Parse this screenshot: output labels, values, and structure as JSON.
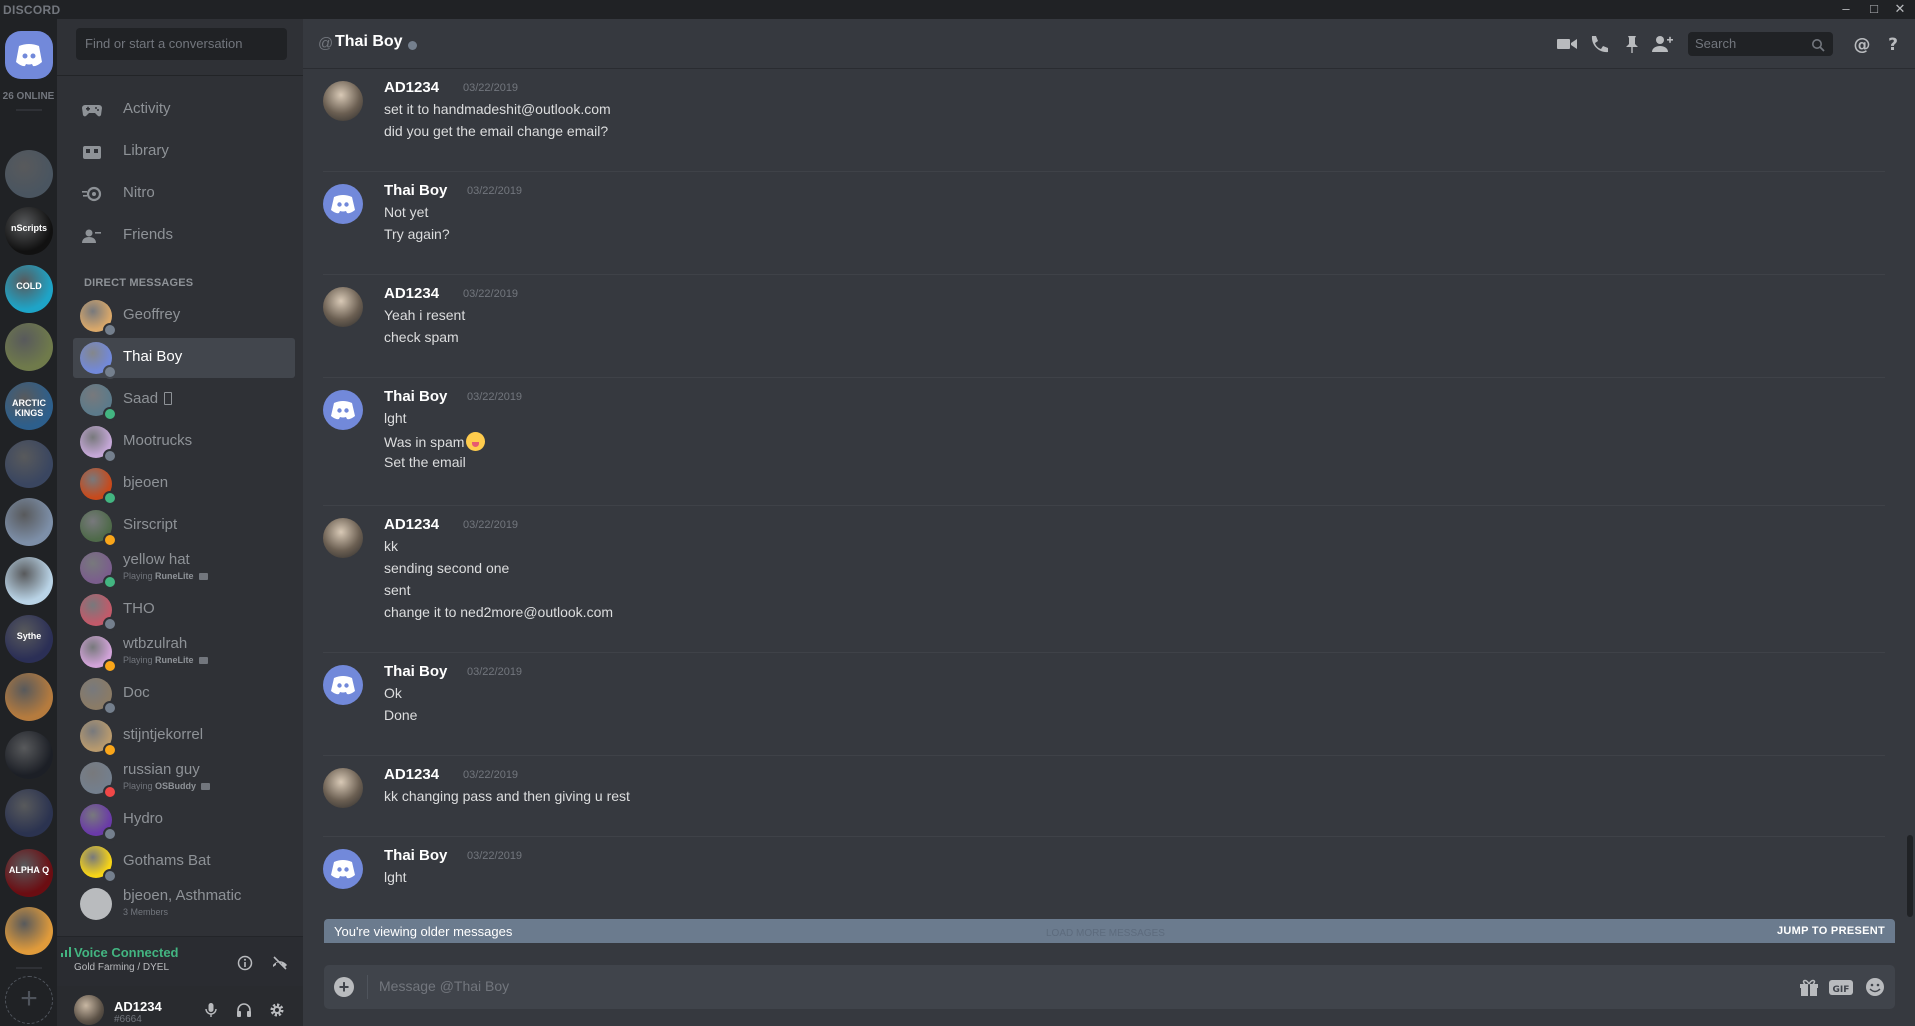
{
  "app": {
    "brand": "DISCORD",
    "window_controls": [
      "minimize-icon",
      "maximize-icon",
      "close-icon"
    ]
  },
  "servers": {
    "online_count": "26 ONLINE",
    "items": [
      {
        "name": "server-dark-ring",
        "color": "#4a5560"
      },
      {
        "name": "server-nscripts",
        "label": "nScripts",
        "color": "#111111"
      },
      {
        "name": "server-cold",
        "label": "COLD",
        "color": "#1ea4c7"
      },
      {
        "name": "server-palm",
        "color": "#6f7a4b"
      },
      {
        "name": "server-arctic-kings",
        "label": "ARCTIC KINGS",
        "color": "#2d5f8c"
      },
      {
        "name": "server-gorilla",
        "color": "#3a4660"
      },
      {
        "name": "server-otter",
        "color": "#7d8fa8"
      },
      {
        "name": "server-face",
        "color": "#b9d3e6"
      },
      {
        "name": "server-sythe",
        "label": "Sythe",
        "color": "#2b2f56"
      },
      {
        "name": "server-warrior",
        "color": "#b57b3e"
      },
      {
        "name": "server-batman",
        "color": "#1c1f26"
      },
      {
        "name": "server-knights",
        "color": "#2b3350"
      },
      {
        "name": "server-alpha",
        "label": "ALPHA Q",
        "color": "#6b0d12"
      },
      {
        "name": "server-hut",
        "color": "#e09b3b"
      }
    ]
  },
  "sidebar": {
    "finder_placeholder": "Find or start a conversation",
    "nav": [
      {
        "label": "Activity",
        "icon": "gamepad-icon"
      },
      {
        "label": "Library",
        "icon": "library-icon"
      },
      {
        "label": "Nitro",
        "icon": "nitro-icon"
      },
      {
        "label": "Friends",
        "icon": "friends-icon"
      }
    ],
    "dm_header": "DIRECT MESSAGES",
    "dms": [
      {
        "name": "Geoffrey",
        "status": "#747f8d",
        "avatar": "#d9a86a"
      },
      {
        "name": "Thai Boy",
        "status": "#747f8d",
        "avatar": "#7289da",
        "active": true
      },
      {
        "name": "Saad",
        "status": "#43b581",
        "avatar": "#5c7a8a",
        "mobile": true
      },
      {
        "name": "Mootrucks",
        "status": "#747f8d",
        "avatar": "#c4a7d6"
      },
      {
        "name": "bjeoen",
        "status": "#43b581",
        "avatar": "#c74a1c"
      },
      {
        "name": "Sirscript",
        "status": "#faa61a",
        "avatar": "#4f6a4a"
      },
      {
        "name": "yellow hat",
        "status": "#43b581",
        "avatar": "#7a5e8c",
        "activity_prefix": "Playing ",
        "activity": "RuneLite"
      },
      {
        "name": "THO",
        "status": "#747f8d",
        "avatar": "#c25a6a"
      },
      {
        "name": "wtbzulrah",
        "status": "#faa61a",
        "avatar": "#d1a3d8",
        "activity_prefix": "Playing ",
        "activity": "RuneLite"
      },
      {
        "name": "Doc",
        "status": "#747f8d",
        "avatar": "#8a7b66"
      },
      {
        "name": "stijntjekorrel",
        "status": "#faa61a",
        "avatar": "#b89a6e"
      },
      {
        "name": "russian guy",
        "status": "#f04747",
        "avatar": "#747f8d",
        "activity_prefix": "Playing ",
        "activity": "OSBuddy"
      },
      {
        "name": "Hydro",
        "status": "#747f8d",
        "avatar": "#6a3aa8"
      },
      {
        "name": "Gothams Bat",
        "status": "#747f8d",
        "avatar": "#f7d417"
      },
      {
        "name": "bjeoen, Asthmatic",
        "avatar": "#b9bbbe",
        "members": "3 Members",
        "group": true
      }
    ],
    "voice": {
      "title": "Voice Connected",
      "channel": "Gold Farming / DYEL"
    },
    "user": {
      "name": "AD1234",
      "tag": "#6664"
    }
  },
  "header": {
    "at": "@",
    "title": "Thai Boy",
    "search_placeholder": "Search"
  },
  "messages": [
    {
      "author": "AD1234",
      "time": "03/22/2019",
      "kind": "user",
      "lines": [
        "set it to handmadeshit@outlook.com",
        "did you get the email change email?"
      ]
    },
    {
      "author": "Thai Boy",
      "time": "03/22/2019",
      "kind": "discord",
      "lines": [
        "Not yet",
        "Try again?"
      ]
    },
    {
      "author": "AD1234",
      "time": "03/22/2019",
      "kind": "user",
      "lines": [
        "Yeah i resent",
        "check spam"
      ]
    },
    {
      "author": "Thai Boy",
      "time": "03/22/2019",
      "kind": "discord",
      "lines": [
        "lght",
        "Was in spam",
        "Set the email"
      ]
    },
    {
      "author": "AD1234",
      "time": "03/22/2019",
      "kind": "user",
      "lines": [
        "kk",
        "sending second one",
        "sent",
        "change it to ned2more@outlook.com"
      ]
    },
    {
      "author": "Thai Boy",
      "time": "03/22/2019",
      "kind": "discord",
      "lines": [
        "Ok",
        "Done"
      ]
    },
    {
      "author": "AD1234",
      "time": "03/22/2019",
      "kind": "user",
      "lines": [
        "kk changing pass and then giving u rest"
      ]
    },
    {
      "author": "Thai Boy",
      "time": "03/22/2019",
      "kind": "discord",
      "lines": [
        "lght"
      ]
    }
  ],
  "older_bar": {
    "label": "You're viewing older messages",
    "load_more": "LOAD MORE MESSAGES",
    "jump": "JUMP TO PRESENT"
  },
  "composer": {
    "placeholder": "Message @Thai Boy"
  }
}
